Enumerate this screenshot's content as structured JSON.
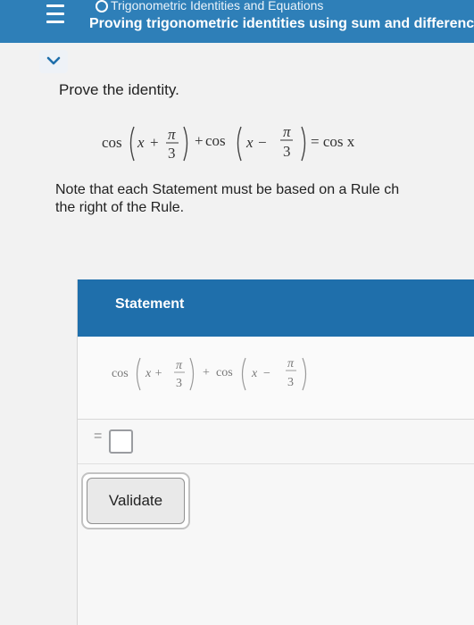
{
  "header": {
    "topic": "Trigonometric Identities and Equations",
    "title": "Proving trigonometric identities using sum and difference"
  },
  "problem": {
    "prompt": "Prove the identity.",
    "identity": {
      "cos1": "cos",
      "arg1_x": "x",
      "arg1_op": "+",
      "pi": "π",
      "three": "3",
      "plus": "+",
      "cos2": "cos",
      "arg2_x": "x",
      "arg2_op": "−",
      "rhs": "= cos x"
    },
    "note_line1": "Note that each Statement must be based on a Rule ch",
    "note_line2": "the right of the Rule."
  },
  "table": {
    "header": "Statement",
    "statement": {
      "cos1": "cos",
      "arg1": "x +",
      "plus": "+",
      "cos2": "cos",
      "arg2_x": "x",
      "arg2_op": "−",
      "pi": "π",
      "three": "3"
    },
    "equals": "=",
    "validate_label": "Validate"
  }
}
